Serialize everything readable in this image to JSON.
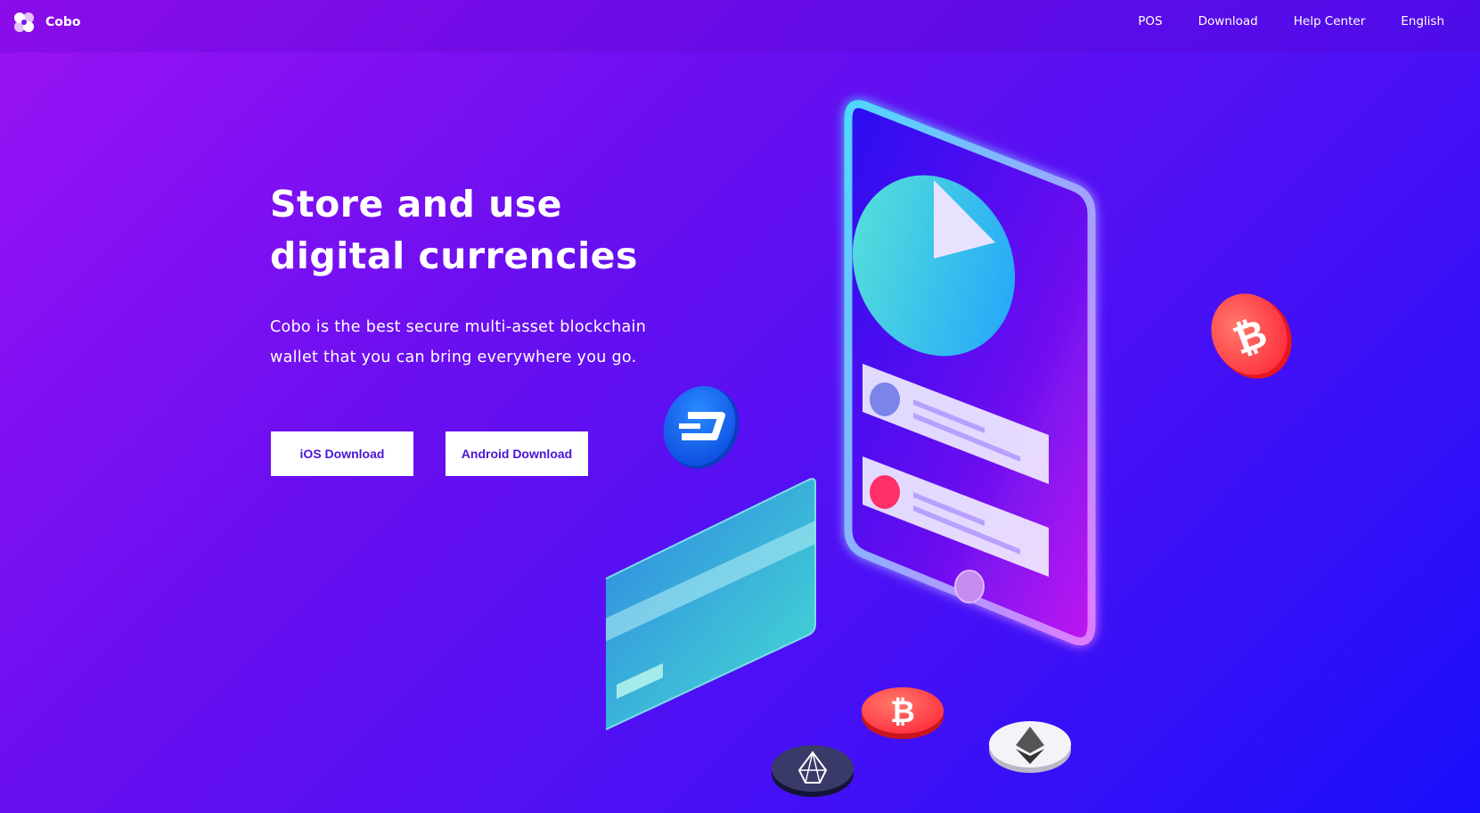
{
  "header": {
    "brand": "Cobo",
    "nav": [
      {
        "label": "POS"
      },
      {
        "label": "Download"
      },
      {
        "label": "Help Center"
      },
      {
        "label": "English"
      }
    ]
  },
  "hero": {
    "title_line1": "Store and use",
    "title_line2": "digital currencies",
    "description_line1": "Cobo is the best secure multi-asset blockchain",
    "description_line2": "wallet that you can bring everywhere you go.",
    "ios_button": "iOS Download",
    "android_button": "Android Download"
  },
  "illustration": {
    "icons": [
      "phone-icon",
      "pie-chart-icon",
      "credit-card-icon",
      "dash-coin-icon",
      "bitcoin-coin-icon",
      "ethereum-coin-icon",
      "eos-coin-icon"
    ]
  },
  "colors": {
    "background_start": "#9b12f5",
    "background_end": "#1a0ffa",
    "button_bg": "#ffffff",
    "button_text": "#4a14d8",
    "bitcoin": "#ff4d4d",
    "dash": "#1e6cff",
    "card": "#3ee7c9"
  }
}
